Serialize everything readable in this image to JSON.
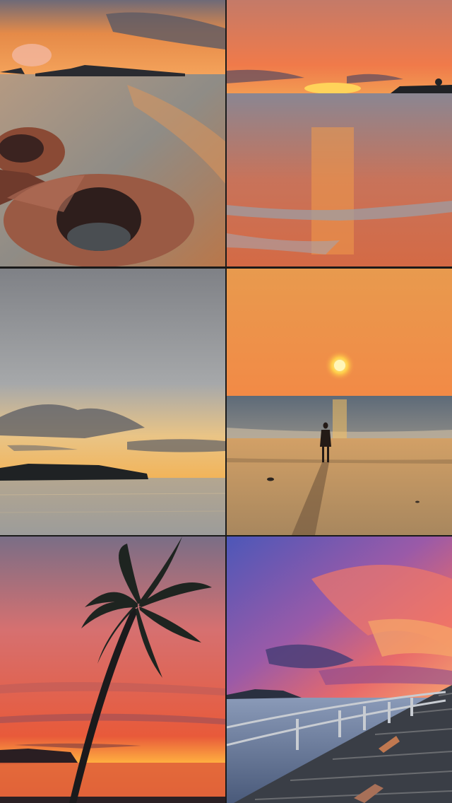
{
  "collage": {
    "photos": [
      {
        "subject": "sunset-sea-with-rusty-concrete-rings"
      },
      {
        "subject": "sunset-over-waves-with-island"
      },
      {
        "subject": "dusk-sky-with-dark-island"
      },
      {
        "subject": "person-silhouette-on-beach-at-sunset"
      },
      {
        "subject": "palm-tree-against-red-sunset"
      },
      {
        "subject": "pink-purple-sky-over-wooden-pier"
      }
    ],
    "palette": {
      "sunset_orange": "#f08a3c",
      "deep_red": "#d8452a",
      "dusk_purple": "#5a4a9a",
      "sea_grey": "#8a8e92",
      "silhouette": "#1b1d1f"
    }
  }
}
